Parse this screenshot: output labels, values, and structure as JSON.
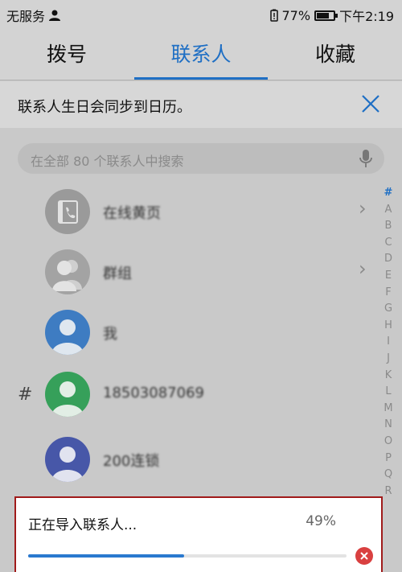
{
  "status_bar": {
    "carrier": "无服务",
    "battery_pct": "77%",
    "battery_level": 0.77,
    "time": "下午2:19",
    "icons": [
      "person-icon",
      "battery-alert-icon",
      "battery-icon"
    ]
  },
  "tabs": [
    {
      "label": "拨号",
      "active": false
    },
    {
      "label": "联系人",
      "active": true
    },
    {
      "label": "收藏",
      "active": false
    }
  ],
  "banner": {
    "text": "联系人生日会同步到日历。",
    "close_icon": "close-icon"
  },
  "search": {
    "placeholder": "在全部 80 个联系人中搜索",
    "icon": "mic-icon"
  },
  "contacts": [
    {
      "name": "在线黄页",
      "avatar": "yellow-pages-icon",
      "chevron": true
    },
    {
      "name": "群组",
      "avatar": "group-icon",
      "chevron": true
    },
    {
      "name": "我",
      "avatar": "person-avatar",
      "color": "#3e7cc2"
    },
    {
      "name": "18503087069",
      "avatar": "person-avatar",
      "color": "#36a05a",
      "section": "#"
    },
    {
      "name": "200连锁",
      "avatar": "person-avatar",
      "color": "#4757a8"
    }
  ],
  "index_letters": [
    "#",
    "A",
    "B",
    "C",
    "D",
    "E",
    "F",
    "G",
    "H",
    "I",
    "J",
    "K",
    "L",
    "M",
    "N",
    "O",
    "P",
    "Q",
    "R"
  ],
  "import_dialog": {
    "title": "正在导入联系人...",
    "percent_label": "49%",
    "progress": 0.49,
    "cancel_icon": "cancel-icon"
  },
  "colors": {
    "accent": "#1f6fc4",
    "progress": "#2a79cf",
    "cancel": "#d94040"
  }
}
